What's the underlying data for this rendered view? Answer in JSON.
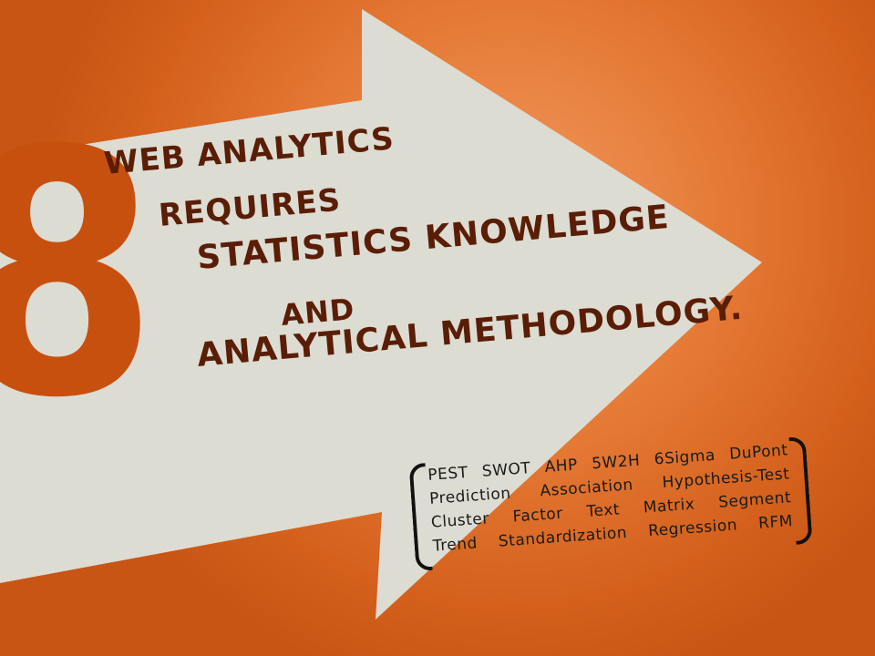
{
  "slide": {
    "number": "8",
    "headline": [
      "WEB ANALYTICS",
      "REQUIRES",
      "STATISTICS KNOWLEDGE",
      "AND",
      "ANALYTICAL METHODOLOGY."
    ],
    "methods": [
      [
        "PEST",
        "SWOT",
        "AHP",
        "5W2H",
        "6Sigma",
        "DuPont"
      ],
      [
        "Prediction",
        "Association",
        "Hypothesis-Test"
      ],
      [
        "Cluster",
        "Factor",
        "Text",
        "Matrix",
        "Segment"
      ],
      [
        "Trend",
        "Standardization",
        "Regression",
        "RFM"
      ]
    ],
    "colors": {
      "background": "#e57a36",
      "arrow": "#dcdcd2",
      "number": "#c8500f",
      "headline": "#5a1d05",
      "methods_text": "#1a1a1a"
    }
  }
}
